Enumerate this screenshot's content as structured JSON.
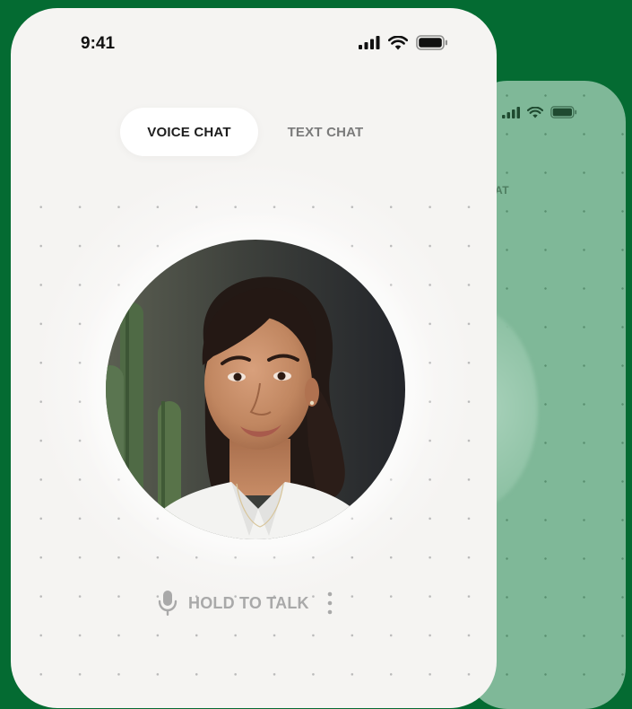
{
  "status_bar": {
    "time": "9:41",
    "icons": [
      "signal-icon",
      "wifi-icon",
      "battery-icon"
    ]
  },
  "tabs": [
    {
      "label": "VOICE CHAT",
      "active": true
    },
    {
      "label": "TEXT CHAT",
      "active": false
    }
  ],
  "avatar": {
    "icon": "person-portrait"
  },
  "talk": {
    "label": "HOLD TO TALK",
    "mic_icon": "microphone-icon",
    "more_icon": "more-vertical-icon"
  },
  "back_phone": {
    "tab_fragment": "AT"
  },
  "colors": {
    "background": "#046b32",
    "back_phone": "#7fb898",
    "front_phone": "#f5f4f2",
    "active_tab": "#ffffff",
    "muted_text": "#a9a9a9"
  }
}
